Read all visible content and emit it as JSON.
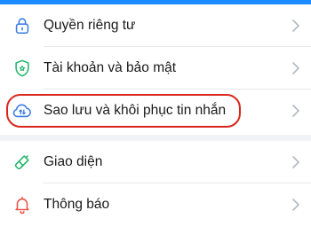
{
  "settings": {
    "items": [
      {
        "label": "Quyền riêng tư",
        "icon": "lock-icon"
      },
      {
        "label": "Tài khoản và bảo mật",
        "icon": "shield-icon"
      },
      {
        "label": "Sao lưu và khôi phục tin nhắn",
        "icon": "cloud-sync-icon"
      },
      {
        "label": "Giao diện",
        "icon": "paint-brush-icon"
      },
      {
        "label": "Thông báo",
        "icon": "bell-icon"
      }
    ]
  },
  "colors": {
    "accent": "#1a8cff",
    "highlight_outline": "#d9261c",
    "shield": "#20b56a",
    "bell": "#e8554a"
  }
}
